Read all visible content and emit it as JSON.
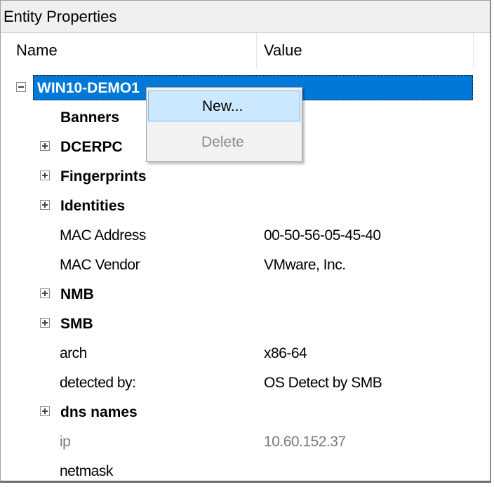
{
  "window": {
    "title": "Entity Properties"
  },
  "columns": {
    "name": "Name",
    "value": "Value"
  },
  "root": {
    "label": "WIN10-DEMO1",
    "expanded": true
  },
  "rows": [
    {
      "label": "Banners",
      "value": "",
      "bold": true,
      "expander": "none"
    },
    {
      "label": "DCERPC",
      "value": "",
      "bold": true,
      "expander": "plus"
    },
    {
      "label": "Fingerprints",
      "value": "",
      "bold": true,
      "expander": "plus"
    },
    {
      "label": "Identities",
      "value": "",
      "bold": true,
      "expander": "plus"
    },
    {
      "label": "MAC Address",
      "value": "00-50-56-05-45-40",
      "bold": false,
      "expander": "none"
    },
    {
      "label": "MAC Vendor",
      "value": "VMware, Inc.",
      "bold": false,
      "expander": "none"
    },
    {
      "label": "NMB",
      "value": "",
      "bold": true,
      "expander": "plus"
    },
    {
      "label": "SMB",
      "value": "",
      "bold": true,
      "expander": "plus"
    },
    {
      "label": "arch",
      "value": "x86-64",
      "bold": false,
      "expander": "none"
    },
    {
      "label": "detected by:",
      "value": "OS Detect by SMB",
      "bold": false,
      "expander": "none"
    },
    {
      "label": "dns names",
      "value": "",
      "bold": true,
      "expander": "plus"
    },
    {
      "label": "ip",
      "value": "10.60.152.37",
      "bold": false,
      "expander": "none",
      "greyed": true
    },
    {
      "label": "netmask",
      "value": "",
      "bold": false,
      "expander": "none"
    }
  ],
  "context_menu": {
    "items": [
      {
        "label": "New...",
        "enabled": true,
        "hovered": true
      },
      {
        "label": "Delete",
        "enabled": false
      }
    ]
  },
  "colors": {
    "selection": "#0078d7",
    "menu_hover": "#cce8ff",
    "disabled_text": "#8c8c8c"
  }
}
